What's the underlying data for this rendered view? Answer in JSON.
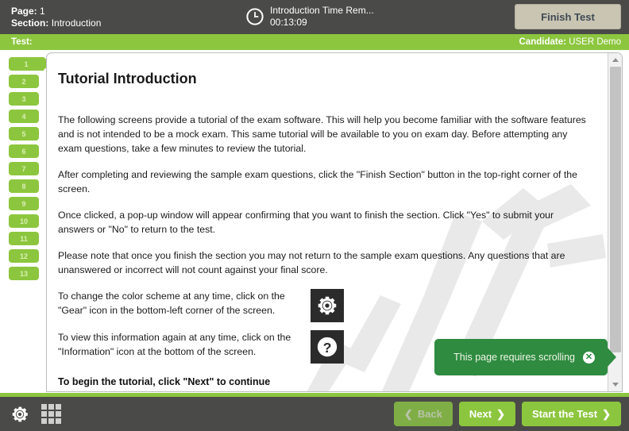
{
  "header": {
    "page_label": "Page:",
    "page_value": "1",
    "section_label": "Section:",
    "section_value": "Introduction",
    "timer_icon": "clock-icon",
    "timer_label": "Introduction Time Rem...",
    "timer_value": "00:13:09",
    "finish_button": "Finish Test"
  },
  "test_bar": {
    "test_label": "Test:",
    "candidate_label": "Candidate:",
    "candidate_value": "USER Demo"
  },
  "page_rail": {
    "pages": [
      "1",
      "2",
      "3",
      "4",
      "5",
      "6",
      "7",
      "8",
      "9",
      "10",
      "11",
      "12",
      "13"
    ],
    "current": "1"
  },
  "content": {
    "title": "Tutorial Introduction",
    "paragraphs": [
      "The following screens provide a tutorial of the exam software. This will help you become familiar with the software features and is not intended to be a mock exam. This same tutorial will be available to you on exam day. Before attempting any exam questions, take a few minutes to review the tutorial.",
      "After completing and reviewing the sample exam questions, click the \"Finish Section\" button in the top-right corner of the screen.",
      "Once clicked, a pop-up window will appear confirming that you want to finish the section. Click \"Yes\" to submit your answers or \"No\" to return to the test.",
      "Please note that once you finish the section you may not return to the sample exam questions. Any questions that are unanswered or incorrect will not count against your final score."
    ],
    "icon_rows": [
      {
        "text": "To change the color scheme at any time, click on the \"Gear\" icon in the bottom-left corner of the screen.",
        "icon": "gear-icon"
      },
      {
        "text": "To view this information again at any time, click on the \"Information\" icon at the bottom of the screen.",
        "icon": "question-mark-icon"
      }
    ],
    "final_line": "To begin the tutorial, click \"Next\" to continue"
  },
  "scroll_hint": {
    "message": "This page requires scrolling",
    "close_icon": "close-icon",
    "close_glyph": "✕"
  },
  "bottom_bar": {
    "gear_icon": "gear-icon",
    "grid_icon": "grid-icon",
    "back_label": "Back",
    "back_chevron": "❮",
    "next_label": "Next",
    "next_chevron": "❯",
    "start_label": "Start the Test",
    "start_chevron": "❯"
  },
  "colors": {
    "brand_green": "#8cc63e",
    "dark_chrome": "#4a4a48",
    "hint_green": "#2e8b40",
    "finish_beige": "#c9c5b2",
    "disabled_green": "#7eae45"
  }
}
